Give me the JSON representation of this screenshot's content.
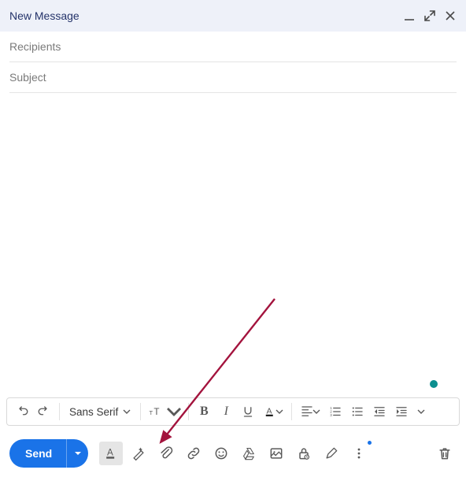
{
  "header": {
    "title": "New Message"
  },
  "fields": {
    "recipients_placeholder": "Recipients",
    "subject_placeholder": "Subject"
  },
  "format": {
    "font_label": "Sans Serif"
  },
  "bottom": {
    "send_label": "Send"
  },
  "colors": {
    "stroke": "#595959",
    "accent": "#1a73e8",
    "arrow": "#a3133d"
  }
}
